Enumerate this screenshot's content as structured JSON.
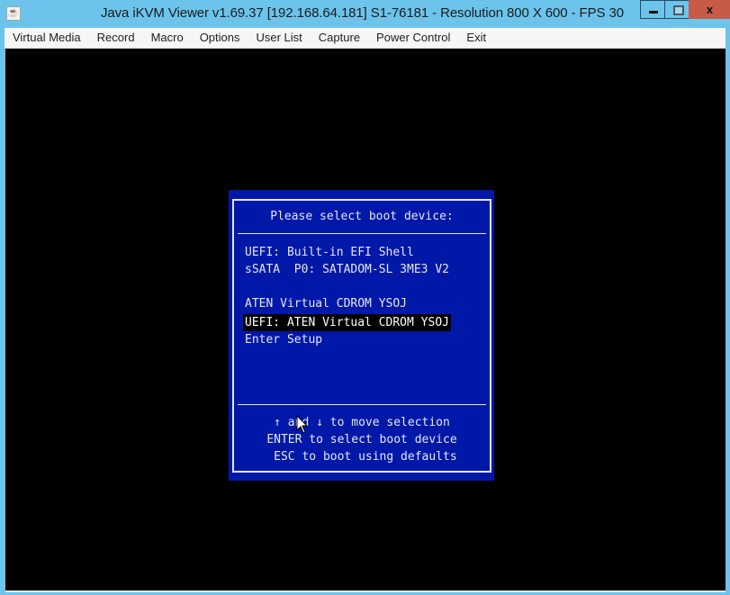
{
  "window": {
    "title": "Java iKVM Viewer v1.69.37 [192.168.64.181] S1-76181 - Resolution 800 X 600 - FPS 30",
    "app_icon": "java-icon",
    "controls": {
      "minimize": "minimize-icon",
      "maximize": "maximize-icon",
      "close_label": "x"
    }
  },
  "menubar": {
    "items": [
      "Virtual Media",
      "Record",
      "Macro",
      "Options",
      "User List",
      "Capture",
      "Power Control",
      "Exit"
    ]
  },
  "bios": {
    "title": "Please select boot device:",
    "items": [
      {
        "label": "UEFI: Built-in EFI Shell",
        "selected": false
      },
      {
        "label": "sSATA  P0: SATADOM-SL 3ME3 V2",
        "selected": false
      },
      {
        "label": "",
        "selected": false
      },
      {
        "label": "ATEN Virtual CDROM YSOJ",
        "selected": false
      },
      {
        "label": "UEFI: ATEN Virtual CDROM YSOJ",
        "selected": true
      },
      {
        "label": "Enter Setup",
        "selected": false
      }
    ],
    "help": [
      "↑ and ↓ to move selection",
      "ENTER to select boot device",
      " ESC to boot using defaults"
    ],
    "colors": {
      "background": "#0018a8",
      "text": "#e6e6f0",
      "highlight": "#000000"
    }
  }
}
